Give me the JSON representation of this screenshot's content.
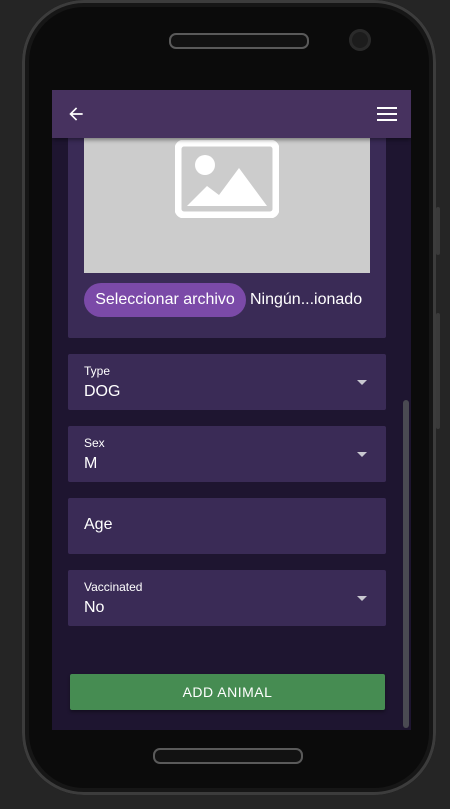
{
  "appbar": {
    "back_icon": "arrow-left-icon",
    "menu_icon": "hamburger-menu-icon"
  },
  "upload": {
    "placeholder_icon": "image-placeholder-icon",
    "choose_file_label": "Seleccionar archivo",
    "file_status": "Ningún...ionado"
  },
  "form": {
    "type": {
      "label": "Type",
      "value": "DOG"
    },
    "sex": {
      "label": "Sex",
      "value": "M"
    },
    "age": {
      "placeholder": "Age"
    },
    "vaccinated": {
      "label": "Vaccinated",
      "value": "No"
    }
  },
  "submit_label": "ADD ANIMAL",
  "colors": {
    "appbar": "#47325f",
    "card": "#3a2b56",
    "button_green": "#468c52",
    "file_button": "#7b4aa8"
  }
}
